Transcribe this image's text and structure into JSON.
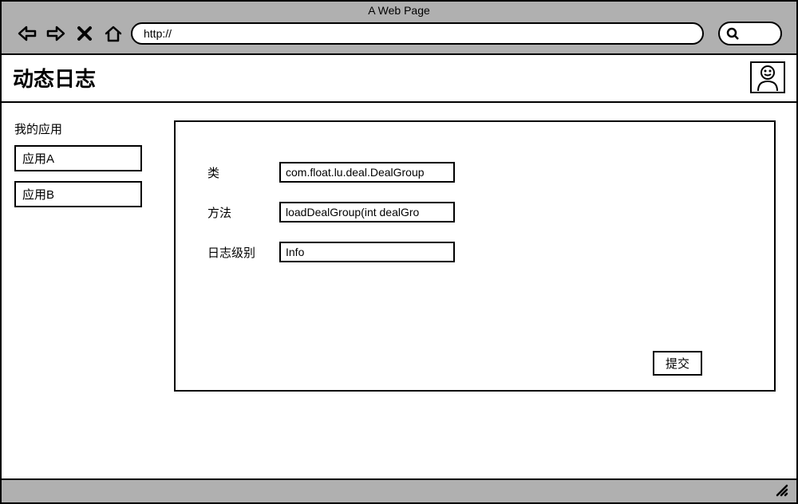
{
  "window": {
    "title": "A Web Page",
    "url": "http://"
  },
  "header": {
    "title": "动态日志"
  },
  "sidebar": {
    "heading": "我的应用",
    "items": [
      {
        "label": "应用A"
      },
      {
        "label": "应用B"
      }
    ]
  },
  "form": {
    "fields": {
      "class": {
        "label": "类",
        "value": "com.float.lu.deal.DealGroup"
      },
      "method": {
        "label": "方法",
        "value": "loadDealGroup(int dealGro"
      },
      "level": {
        "label": "日志级别",
        "value": "Info"
      }
    },
    "submit_label": "提交"
  }
}
